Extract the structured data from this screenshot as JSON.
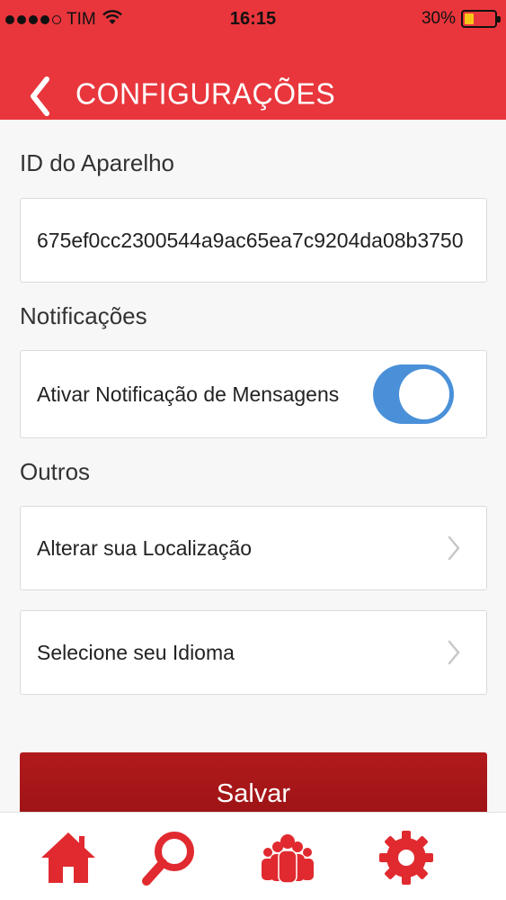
{
  "status_bar": {
    "carrier": "TIM",
    "time": "16:15",
    "battery_percent": "30%",
    "battery_level": 0.3,
    "signal_dots_filled": 4,
    "signal_dots_total": 5
  },
  "header": {
    "title": "CONFIGURAÇÕES",
    "back_icon": "chevron-left-icon"
  },
  "device_id": {
    "label": "ID do Aparelho",
    "value": "675ef0cc2300544a9ac65ea7c9204da08b3750"
  },
  "notifications": {
    "label": "Notificações",
    "message_toggle_label": "Ativar Notificação de Mensagens",
    "message_toggle_on": true
  },
  "others": {
    "label": "Outros",
    "items": [
      {
        "label": "Alterar sua Localização",
        "icon": "chevron-right-icon"
      },
      {
        "label": "Selecione seu Idioma",
        "icon": "chevron-right-icon"
      }
    ]
  },
  "save_button": {
    "label": "Salvar"
  },
  "tabbar": {
    "tabs": [
      {
        "name": "home",
        "icon": "home-icon"
      },
      {
        "name": "search",
        "icon": "search-icon"
      },
      {
        "name": "people",
        "icon": "people-icon"
      },
      {
        "name": "settings",
        "icon": "gear-icon"
      }
    ]
  },
  "colors": {
    "header_red": "#e8363c",
    "save_red": "#a81618",
    "toggle_blue": "#4a90d9",
    "tab_icon_red": "#e02a2f",
    "battery_yellow": "#f7c518"
  }
}
